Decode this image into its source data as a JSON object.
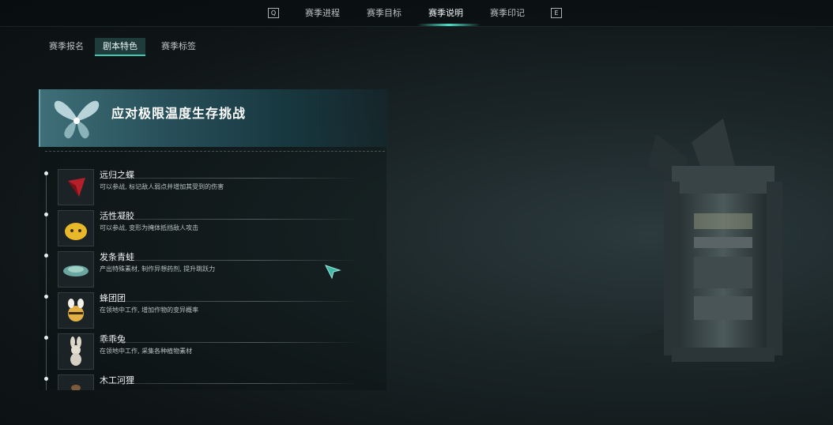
{
  "top_nav": {
    "key_left": "Q",
    "key_right": "E",
    "tabs": [
      {
        "label": "赛季进程"
      },
      {
        "label": "赛季目标"
      },
      {
        "label": "赛季说明"
      },
      {
        "label": "赛季印记"
      }
    ],
    "active_tab": "赛季说明"
  },
  "sub_tabs": [
    {
      "label": "赛季报名"
    },
    {
      "label": "剧本特色"
    },
    {
      "label": "赛季标签"
    }
  ],
  "active_sub_tab": "剧本特色",
  "banner": {
    "title": "应对极限温度生存挑战",
    "icon": "butterfly-emblem-icon"
  },
  "list": {
    "items": [
      {
        "name": "远归之蝶",
        "desc": "可以参战, 标记敌人弱点并增加其受到的伤害",
        "icon": "red-crystal-icon"
      },
      {
        "name": "活性凝胶",
        "desc": "可以参战, 变形为掩体抵挡敌人攻击",
        "icon": "yellow-slime-icon"
      },
      {
        "name": "发条青蛙",
        "desc": "产出特殊素材, 制作异想药剂, 提升跳跃力",
        "icon": "clockwork-frog-icon"
      },
      {
        "name": "蜂团团",
        "desc": "在领地中工作, 增加作物的变异概率",
        "icon": "bee-icon"
      },
      {
        "name": "乖乖兔",
        "desc": "在领地中工作, 采集各种植物素材",
        "icon": "rabbit-icon"
      },
      {
        "name": "木工河狸",
        "desc": "",
        "icon": "beaver-icon"
      }
    ]
  },
  "colors": {
    "accent": "#4fe0c8",
    "banner": "#3e6f78",
    "background": "#141c1e"
  }
}
